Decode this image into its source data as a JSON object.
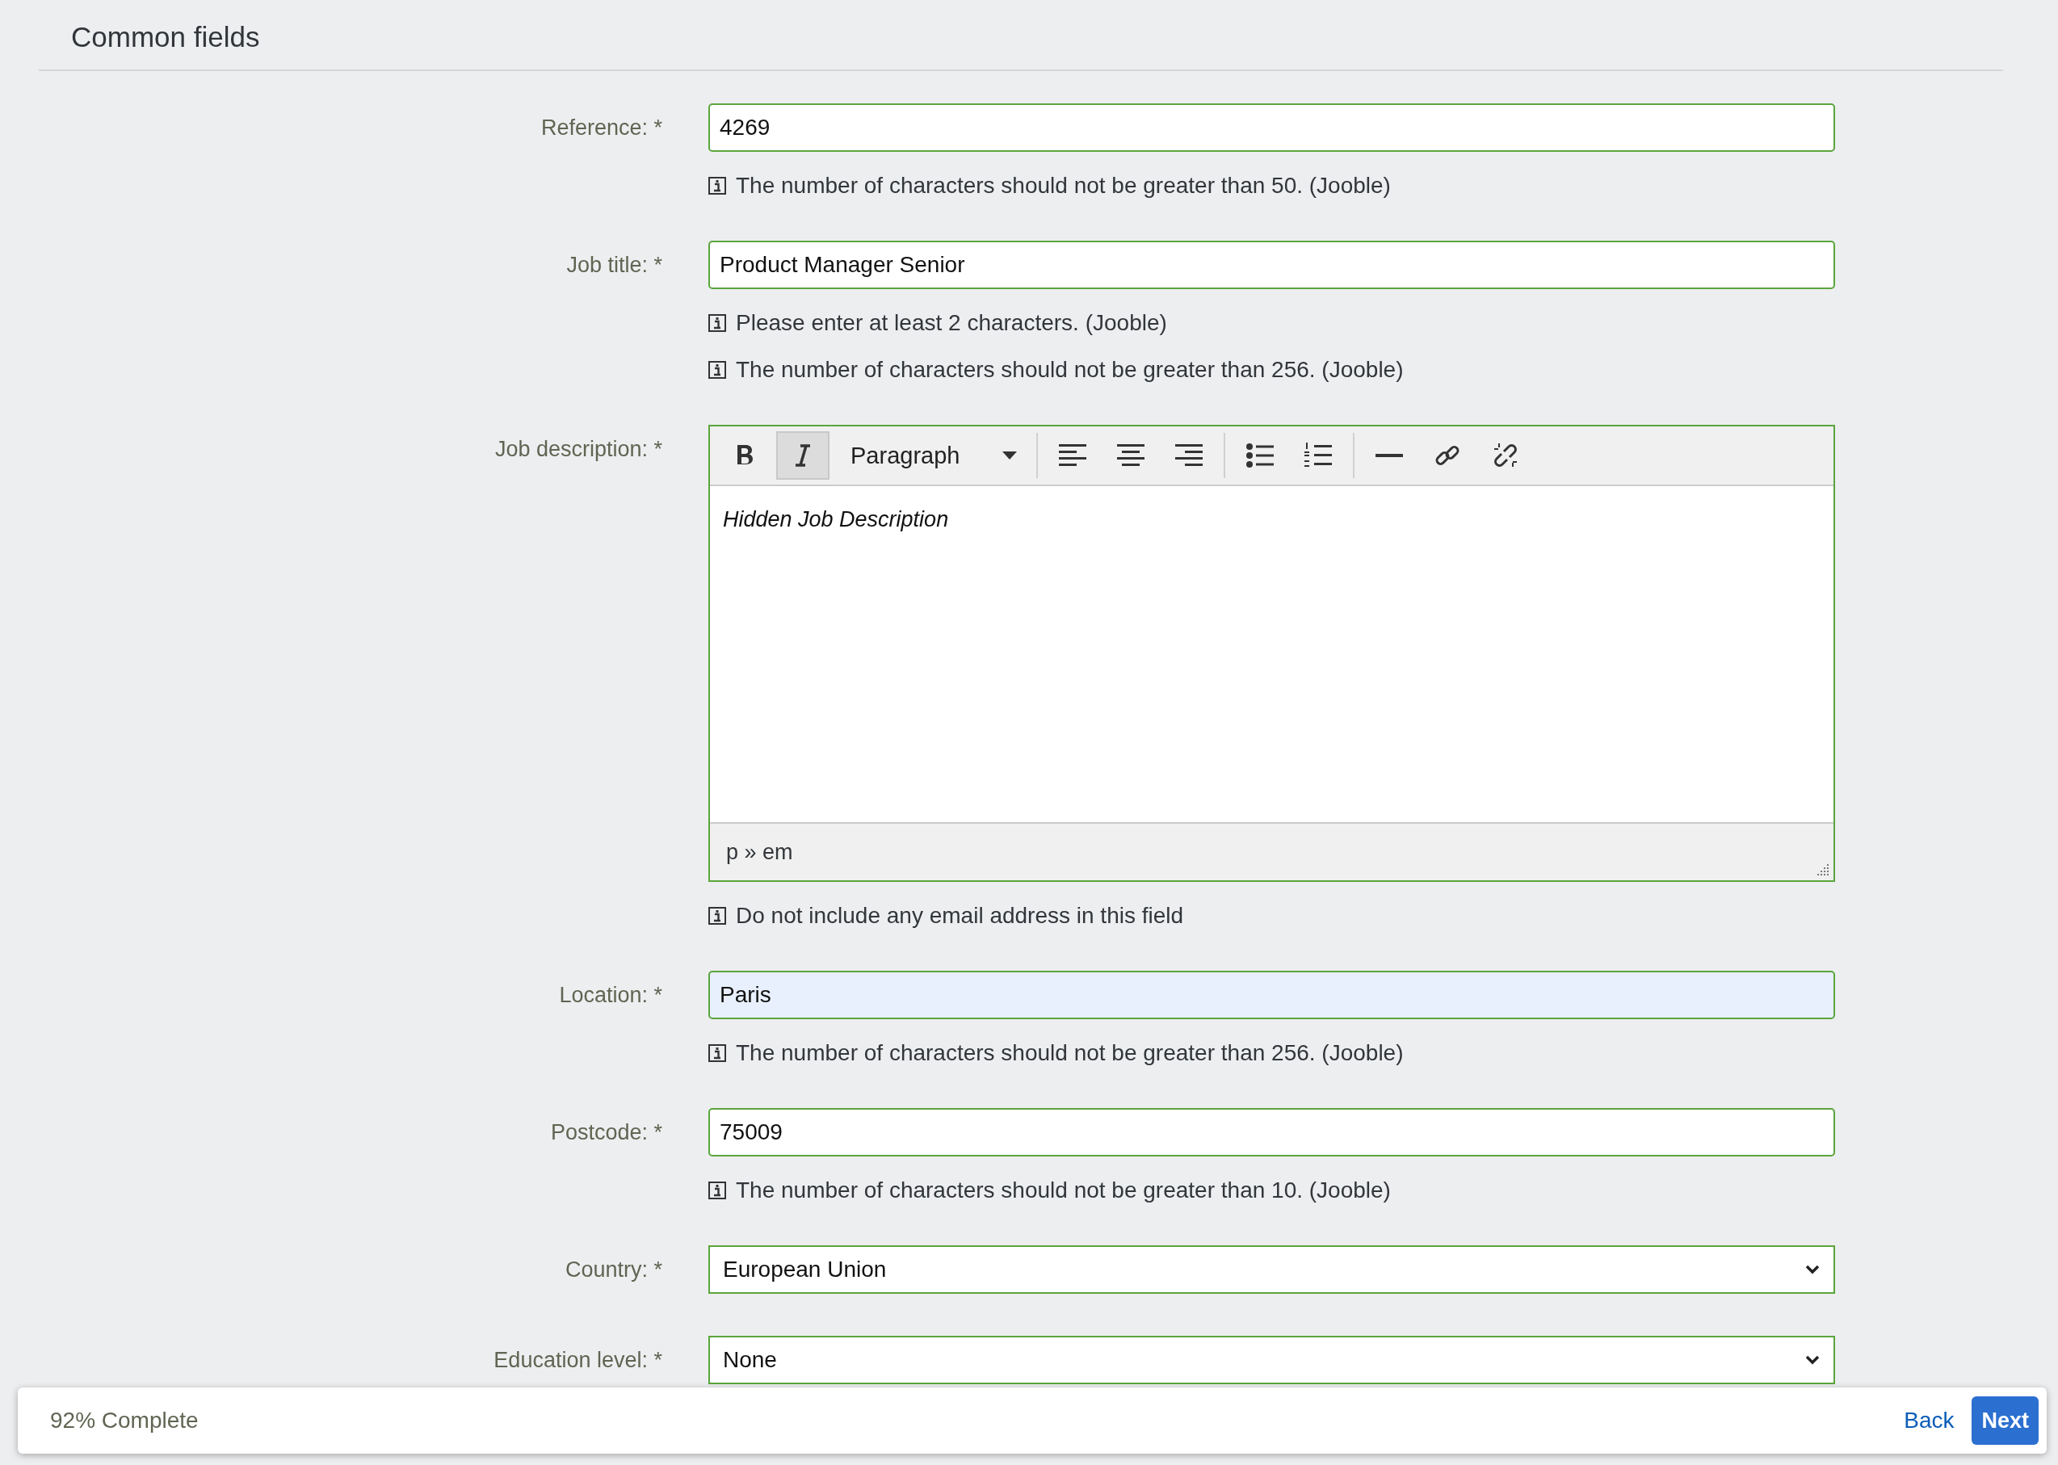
{
  "section": {
    "title": "Common fields"
  },
  "fields": [
    {
      "kind": "text",
      "label": "Reference: *",
      "value": "4269",
      "highlighted": false,
      "hints": [
        "The number of characters should not be greater than 50. (Jooble)"
      ]
    },
    {
      "kind": "text",
      "label": "Job title: *",
      "value": "Product Manager Senior",
      "highlighted": false,
      "hints": [
        "Please enter at least 2 characters. (Jooble)",
        "The number of characters should not be greater than 256. (Jooble)"
      ]
    },
    {
      "kind": "editor",
      "label": "Job description: *",
      "value": "Hidden Job Description",
      "path": "p » em",
      "format": "Paragraph",
      "toolbar": [
        {
          "kind": "bold",
          "selected": false
        },
        {
          "kind": "italic",
          "selected": true
        },
        {
          "kind": "format"
        },
        {
          "kind": "align-left",
          "selected": false
        },
        {
          "kind": "align-center",
          "selected": false
        },
        {
          "kind": "align-right",
          "selected": false
        },
        {
          "kind": "bullet-list",
          "selected": false
        },
        {
          "kind": "numbered-list",
          "selected": false
        },
        {
          "kind": "rule",
          "selected": false
        },
        {
          "kind": "link",
          "selected": false
        },
        {
          "kind": "unlink",
          "selected": false
        }
      ],
      "hints": [
        "Do not include any email address in this field"
      ]
    },
    {
      "kind": "text",
      "label": "Location: *",
      "value": "Paris",
      "highlighted": true,
      "hints": [
        "The number of characters should not be greater than 256. (Jooble)"
      ]
    },
    {
      "kind": "text",
      "label": "Postcode: *",
      "value": "75009",
      "highlighted": false,
      "hints": [
        "The number of characters should not be greater than 10. (Jooble)"
      ]
    },
    {
      "kind": "select",
      "label": "Country: *",
      "value": "European Union"
    },
    {
      "kind": "select",
      "label": "Education level: *",
      "value": "None"
    }
  ],
  "footer": {
    "progress": "92% Complete",
    "back": "Back",
    "next": "Next"
  }
}
